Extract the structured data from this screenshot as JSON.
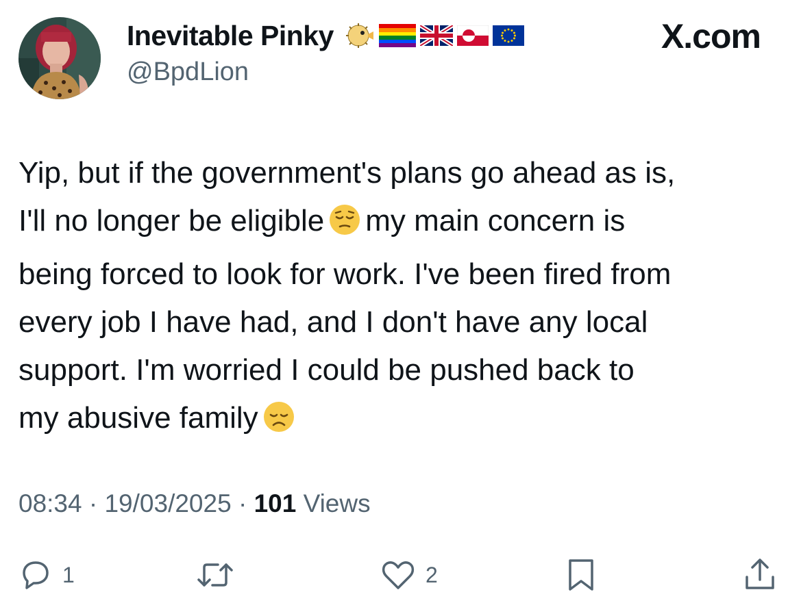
{
  "header": {
    "display_name": "Inevitable Pinky",
    "handle": "@BpdLion",
    "brand": "X.com",
    "name_emojis": [
      "blowfish-icon",
      "rainbow-flag-icon",
      "uk-flag-icon",
      "greenland-flag-icon",
      "eu-flag-icon"
    ]
  },
  "tweet": {
    "lines": [
      {
        "text": "Yip, but if the government's plans go ahead as is,"
      },
      {
        "before": "I'll no longer be eligible",
        "after": "my main concern is",
        "emoji": "pensive-face-icon"
      },
      {
        "text": "being forced to look for work. I've been fired from"
      },
      {
        "text": "every job I have had, and I don't have any local"
      },
      {
        "text": "support. I'm worried I could be pushed back to"
      },
      {
        "before": "my abusive family",
        "emoji": "disappointed-face-icon"
      }
    ]
  },
  "meta": {
    "time": "08:34",
    "sep1": " · ",
    "date": "19/03/2025",
    "sep2": " · ",
    "views_count": "101",
    "views_label": " Views"
  },
  "actions": {
    "replies": "1",
    "likes": "2"
  },
  "colors": {
    "text": "#0f1419",
    "secondary": "#536471"
  }
}
